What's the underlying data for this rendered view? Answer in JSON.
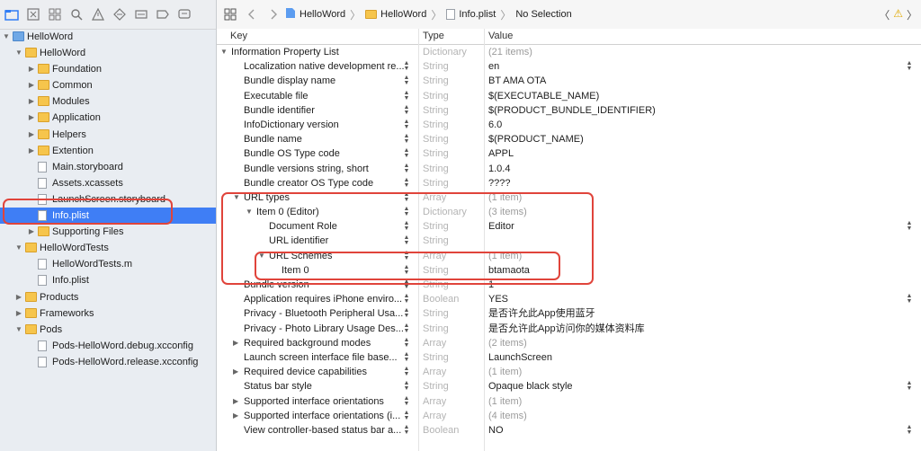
{
  "navigator": {
    "items": [
      {
        "label": "HelloWord",
        "level": 0,
        "icon": "project-icon",
        "disclosure": "open"
      },
      {
        "label": "HelloWord",
        "level": 1,
        "icon": "folder-icon",
        "disclosure": "open"
      },
      {
        "label": "Foundation",
        "level": 2,
        "icon": "folder-icon",
        "disclosure": "closed"
      },
      {
        "label": "Common",
        "level": 2,
        "icon": "folder-icon",
        "disclosure": "closed"
      },
      {
        "label": "Modules",
        "level": 2,
        "icon": "folder-icon",
        "disclosure": "closed"
      },
      {
        "label": "Application",
        "level": 2,
        "icon": "folder-icon",
        "disclosure": "closed"
      },
      {
        "label": "Helpers",
        "level": 2,
        "icon": "folder-icon",
        "disclosure": "closed"
      },
      {
        "label": "Extention",
        "level": 2,
        "icon": "folder-icon",
        "disclosure": "closed"
      },
      {
        "label": "Main.storyboard",
        "level": 2,
        "icon": "storyboard-icon",
        "disclosure": "none"
      },
      {
        "label": "Assets.xcassets",
        "level": 2,
        "icon": "assets-icon",
        "disclosure": "none"
      },
      {
        "label": "LaunchScreen.storyboard",
        "level": 2,
        "icon": "storyboard-icon",
        "disclosure": "none"
      },
      {
        "label": "Info.plist",
        "level": 2,
        "icon": "plist-icon",
        "disclosure": "none",
        "selected": true
      },
      {
        "label": "Supporting Files",
        "level": 2,
        "icon": "folder-icon",
        "disclosure": "closed"
      },
      {
        "label": "HelloWordTests",
        "level": 1,
        "icon": "folder-icon",
        "disclosure": "open"
      },
      {
        "label": "HelloWordTests.m",
        "level": 2,
        "icon": "objc-file-icon",
        "disclosure": "none"
      },
      {
        "label": "Info.plist",
        "level": 2,
        "icon": "plist-icon",
        "disclosure": "none"
      },
      {
        "label": "Products",
        "level": 1,
        "icon": "folder-icon",
        "disclosure": "closed"
      },
      {
        "label": "Frameworks",
        "level": 1,
        "icon": "folder-icon",
        "disclosure": "closed"
      },
      {
        "label": "Pods",
        "level": 1,
        "icon": "folder-icon",
        "disclosure": "open"
      },
      {
        "label": "Pods-HelloWord.debug.xcconfig",
        "level": 2,
        "icon": "config-file-icon",
        "disclosure": "none"
      },
      {
        "label": "Pods-HelloWord.release.xcconfig",
        "level": 2,
        "icon": "config-file-icon",
        "disclosure": "none"
      }
    ]
  },
  "jumpbar": {
    "project": "HelloWord",
    "folder": "HelloWord",
    "file": "Info.plist",
    "selection": "No Selection"
  },
  "table": {
    "headers": {
      "key": "Key",
      "type": "Type",
      "value": "Value"
    },
    "rows": [
      {
        "key": "Information Property List",
        "type": "Dictionary",
        "value": "(21 items)",
        "level": 0,
        "disclosure": "open",
        "valueGray": true
      },
      {
        "key": "Localization native development re...",
        "type": "String",
        "value": "en",
        "level": 1,
        "disclosure": "none",
        "valuePopup": true
      },
      {
        "key": "Bundle display name",
        "type": "String",
        "value": "BT AMA OTA",
        "level": 1,
        "disclosure": "none"
      },
      {
        "key": "Executable file",
        "type": "String",
        "value": "$(EXECUTABLE_NAME)",
        "level": 1,
        "disclosure": "none"
      },
      {
        "key": "Bundle identifier",
        "type": "String",
        "value": "$(PRODUCT_BUNDLE_IDENTIFIER)",
        "level": 1,
        "disclosure": "none"
      },
      {
        "key": "InfoDictionary version",
        "type": "String",
        "value": "6.0",
        "level": 1,
        "disclosure": "none"
      },
      {
        "key": "Bundle name",
        "type": "String",
        "value": "$(PRODUCT_NAME)",
        "level": 1,
        "disclosure": "none"
      },
      {
        "key": "Bundle OS Type code",
        "type": "String",
        "value": "APPL",
        "level": 1,
        "disclosure": "none"
      },
      {
        "key": "Bundle versions string, short",
        "type": "String",
        "value": "1.0.4",
        "level": 1,
        "disclosure": "none"
      },
      {
        "key": "Bundle creator OS Type code",
        "type": "String",
        "value": "????",
        "level": 1,
        "disclosure": "none"
      },
      {
        "key": "URL types",
        "type": "Array",
        "value": "(1 item)",
        "level": 1,
        "disclosure": "open",
        "valueGray": true
      },
      {
        "key": "Item 0 (Editor)",
        "type": "Dictionary",
        "value": "(3 items)",
        "level": 2,
        "disclosure": "open",
        "valueGray": true
      },
      {
        "key": "Document Role",
        "type": "String",
        "value": "Editor",
        "level": 3,
        "disclosure": "none",
        "valuePopup": true
      },
      {
        "key": "URL identifier",
        "type": "String",
        "value": "",
        "level": 3,
        "disclosure": "none"
      },
      {
        "key": "URL Schemes",
        "type": "Array",
        "value": "(1 item)",
        "level": 3,
        "disclosure": "open",
        "valueGray": true
      },
      {
        "key": "Item 0",
        "type": "String",
        "value": "btamaota",
        "level": 4,
        "disclosure": "none"
      },
      {
        "key": "Bundle version",
        "type": "String",
        "value": "1",
        "level": 1,
        "disclosure": "none"
      },
      {
        "key": "Application requires iPhone enviro...",
        "type": "Boolean",
        "value": "YES",
        "level": 1,
        "disclosure": "none",
        "valuePopup": true
      },
      {
        "key": "Privacy - Bluetooth Peripheral Usa...",
        "type": "String",
        "value": "是否许允此App使用蓝牙",
        "level": 1,
        "disclosure": "none"
      },
      {
        "key": "Privacy - Photo Library Usage Des...",
        "type": "String",
        "value": "是否允许此App访问你的媒体资料库",
        "level": 1,
        "disclosure": "none"
      },
      {
        "key": "Required background modes",
        "type": "Array",
        "value": "(2 items)",
        "level": 1,
        "disclosure": "closed",
        "valueGray": true
      },
      {
        "key": "Launch screen interface file base...",
        "type": "String",
        "value": "LaunchScreen",
        "level": 1,
        "disclosure": "none"
      },
      {
        "key": "Required device capabilities",
        "type": "Array",
        "value": "(1 item)",
        "level": 1,
        "disclosure": "closed",
        "valueGray": true
      },
      {
        "key": "Status bar style",
        "type": "String",
        "value": "Opaque black style",
        "level": 1,
        "disclosure": "none",
        "valuePopup": true
      },
      {
        "key": "Supported interface orientations",
        "type": "Array",
        "value": "(1 item)",
        "level": 1,
        "disclosure": "closed",
        "valueGray": true
      },
      {
        "key": "Supported interface orientations (i...",
        "type": "Array",
        "value": "(4 items)",
        "level": 1,
        "disclosure": "closed",
        "valueGray": true
      },
      {
        "key": "View controller-based status bar a...",
        "type": "Boolean",
        "value": "NO",
        "level": 1,
        "disclosure": "none",
        "valuePopup": true
      }
    ]
  },
  "colors": {
    "selection": "#3f7ef5",
    "highlight_box": "#e0443b",
    "folder": "#f6c54c"
  }
}
